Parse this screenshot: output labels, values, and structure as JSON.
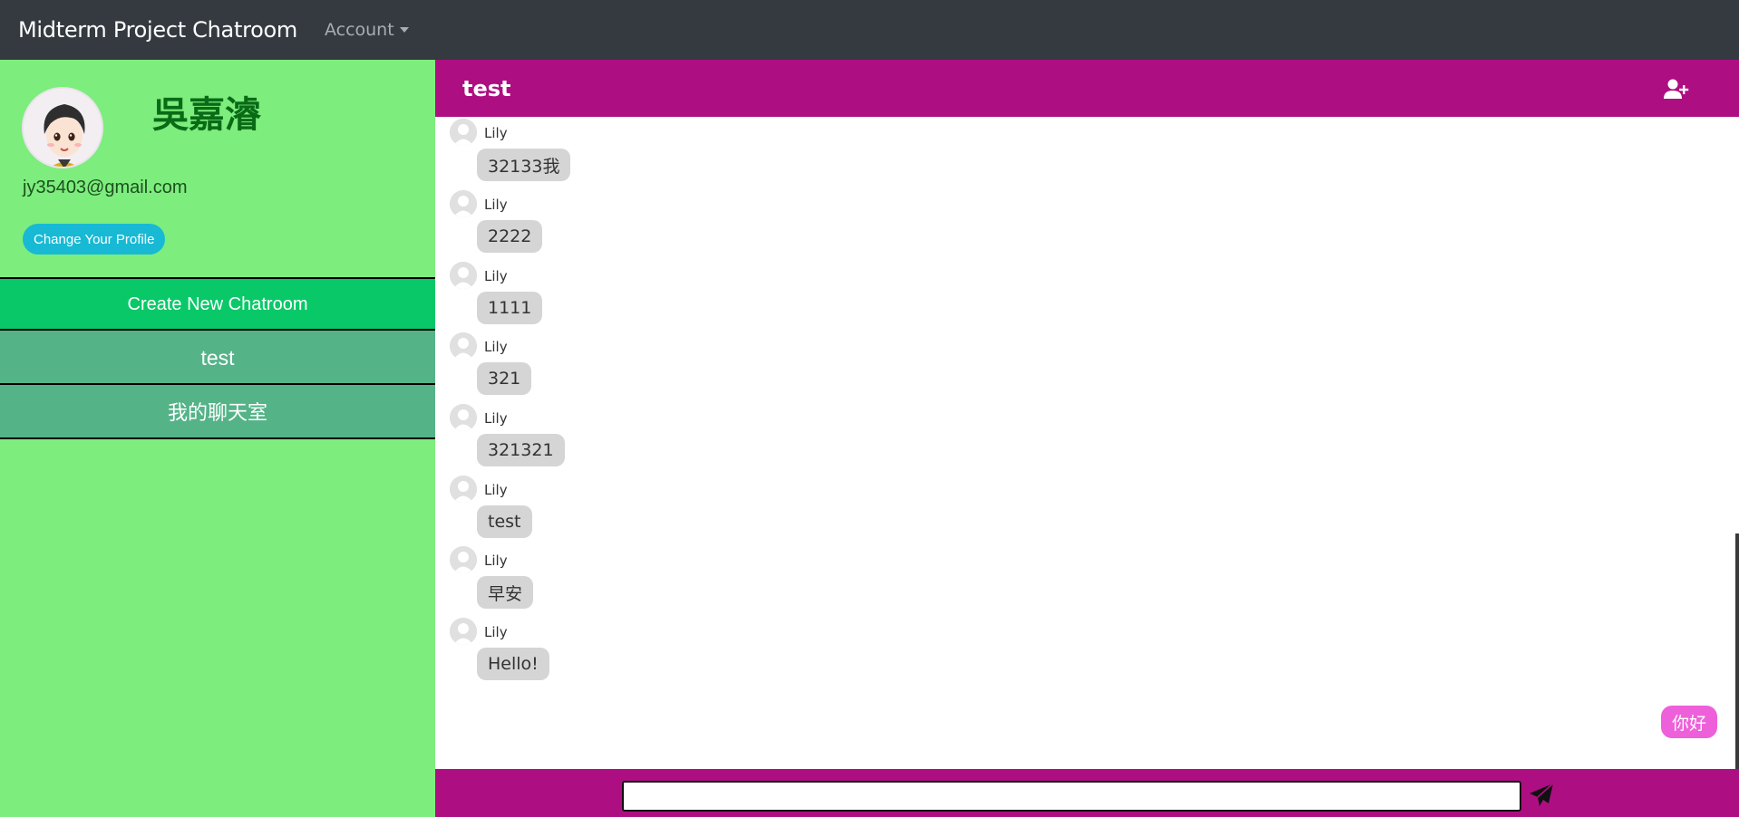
{
  "navbar": {
    "brand": "Midterm Project Chatroom",
    "account_label": "Account"
  },
  "profile": {
    "name": "吳嘉濬",
    "email": "jy35403@gmail.com",
    "change_profile_label": "Change Your Profile"
  },
  "sidebar": {
    "create_room_label": "Create New Chatroom",
    "rooms": [
      {
        "label": "test"
      },
      {
        "label": "我的聊天室"
      }
    ]
  },
  "chat": {
    "title": "test",
    "messages": [
      {
        "sender": "Lily",
        "text": "32133我"
      },
      {
        "sender": "Lily",
        "text": "2222"
      },
      {
        "sender": "Lily",
        "text": "1111"
      },
      {
        "sender": "Lily",
        "text": "321"
      },
      {
        "sender": "Lily",
        "text": "321321"
      },
      {
        "sender": "Lily",
        "text": "test"
      },
      {
        "sender": "Lily",
        "text": "早安"
      },
      {
        "sender": "Lily",
        "text": "Hello!"
      }
    ],
    "own_message": {
      "text": "你好"
    },
    "input": {
      "value": "",
      "placeholder": ""
    }
  },
  "icons": {
    "add_user": "user-plus-icon",
    "send": "paper-plane-icon",
    "avatar": "default-avatar-icon"
  },
  "colors": {
    "navbar": "#343a40",
    "sidebar": "#7ded7d",
    "chat_header": "#ad0f82",
    "create_room": "#09c868",
    "room": "#55b388",
    "profile_button": "#17b9d4",
    "own_bubble": "#ee60d9",
    "bubble": "#d5d5d5"
  }
}
